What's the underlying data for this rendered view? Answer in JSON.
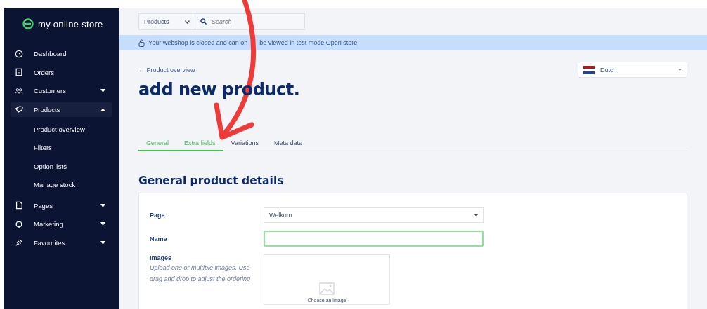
{
  "brand": "my online store",
  "sidebar": {
    "items": [
      {
        "label": "Dashboard",
        "selected": false
      },
      {
        "label": "Orders",
        "selected": false
      },
      {
        "label": "Customers",
        "expanded": false,
        "selected": false
      },
      {
        "label": "Products",
        "expanded": true,
        "selected": true,
        "children": [
          {
            "label": "Product overview"
          },
          {
            "label": "Filters"
          },
          {
            "label": "Option lists"
          },
          {
            "label": "Manage stock"
          }
        ]
      },
      {
        "label": "Pages",
        "expanded": false,
        "selected": false
      },
      {
        "label": "Marketing",
        "expanded": false,
        "selected": false
      },
      {
        "label": "Favourites",
        "expanded": false,
        "selected": false
      }
    ]
  },
  "top_bar": {
    "scope": "Products",
    "search": {
      "placeholder": "Search"
    }
  },
  "banner": {
    "text_before": "Your webshop is closed and can on",
    "text_after": "be viewed in test mode.",
    "link": "Open store"
  },
  "back_link": "← Product overview",
  "language": "Dutch",
  "title": "add new product.",
  "tabs": [
    {
      "label": "General",
      "selected": true
    },
    {
      "label": "Extra fields",
      "selected": true
    },
    {
      "label": "Variations",
      "selected": false
    },
    {
      "label": "Meta data",
      "selected": false
    }
  ],
  "section_title": "General product details",
  "form": {
    "page": {
      "label": "Page",
      "value": "Welkom"
    },
    "name": {
      "label": "Name",
      "focused": true
    },
    "images": {
      "label": "Images",
      "hint": "Upload one or multiple images. Use drag and drop to adjust the ordering",
      "button": "Choose an image"
    }
  }
}
